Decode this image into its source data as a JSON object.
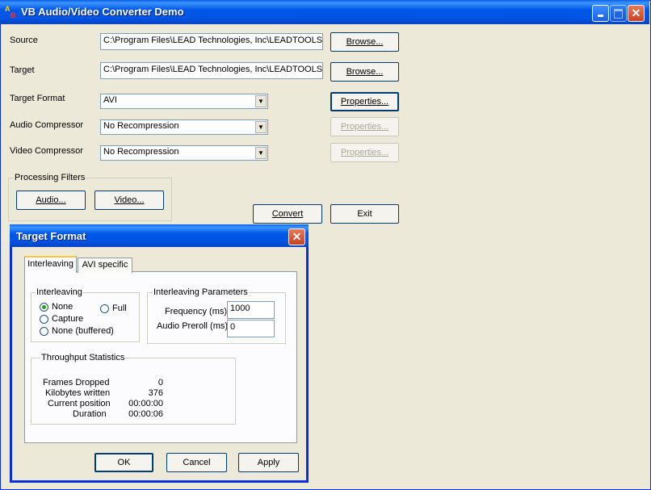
{
  "window": {
    "title": "VB Audio/Video Converter Demo",
    "icon_text_a": "A",
    "icon_text_b": "B"
  },
  "source": {
    "label": "Source",
    "value": "C:\\Program Files\\LEAD Technologies, Inc\\LEADTOOLS",
    "browse": "Browse..."
  },
  "target": {
    "label": "Target",
    "value": "C:\\Program Files\\LEAD Technologies, Inc\\LEADTOOLS",
    "browse": "Browse..."
  },
  "target_format": {
    "label": "Target Format",
    "value": "AVI",
    "properties": "Properties..."
  },
  "audio_compressor": {
    "label": "Audio Compressor",
    "value": "No Recompression",
    "properties": "Properties..."
  },
  "video_compressor": {
    "label": "Video Compressor",
    "value": "No Recompression",
    "properties": "Properties..."
  },
  "processing_filters": {
    "label": "Processing Filters",
    "audio": "Audio...",
    "video": "Video..."
  },
  "convert": "Convert",
  "exit": "Exit",
  "dialog": {
    "title": "Target Format",
    "tabs": [
      "Interleaving",
      "AVI specific"
    ],
    "interleaving": {
      "label": "Interleaving",
      "options": [
        "None",
        "Full",
        "Capture",
        "None (buffered)"
      ],
      "selected": "None"
    },
    "params": {
      "label": "Interleaving Parameters",
      "frequency_label": "Frequency (ms)",
      "frequency_value": "1000",
      "preroll_label": "Audio Preroll (ms)",
      "preroll_value": "0"
    },
    "stats": {
      "label": "Throughput Statistics",
      "rows": [
        {
          "name": "Frames Dropped",
          "value": "0"
        },
        {
          "name": "Kilobytes written",
          "value": "376"
        },
        {
          "name": "Current position",
          "value": "00:00:00"
        },
        {
          "name": "Duration",
          "value": "00:00:06"
        }
      ]
    },
    "ok": "OK",
    "cancel": "Cancel",
    "apply": "Apply"
  }
}
